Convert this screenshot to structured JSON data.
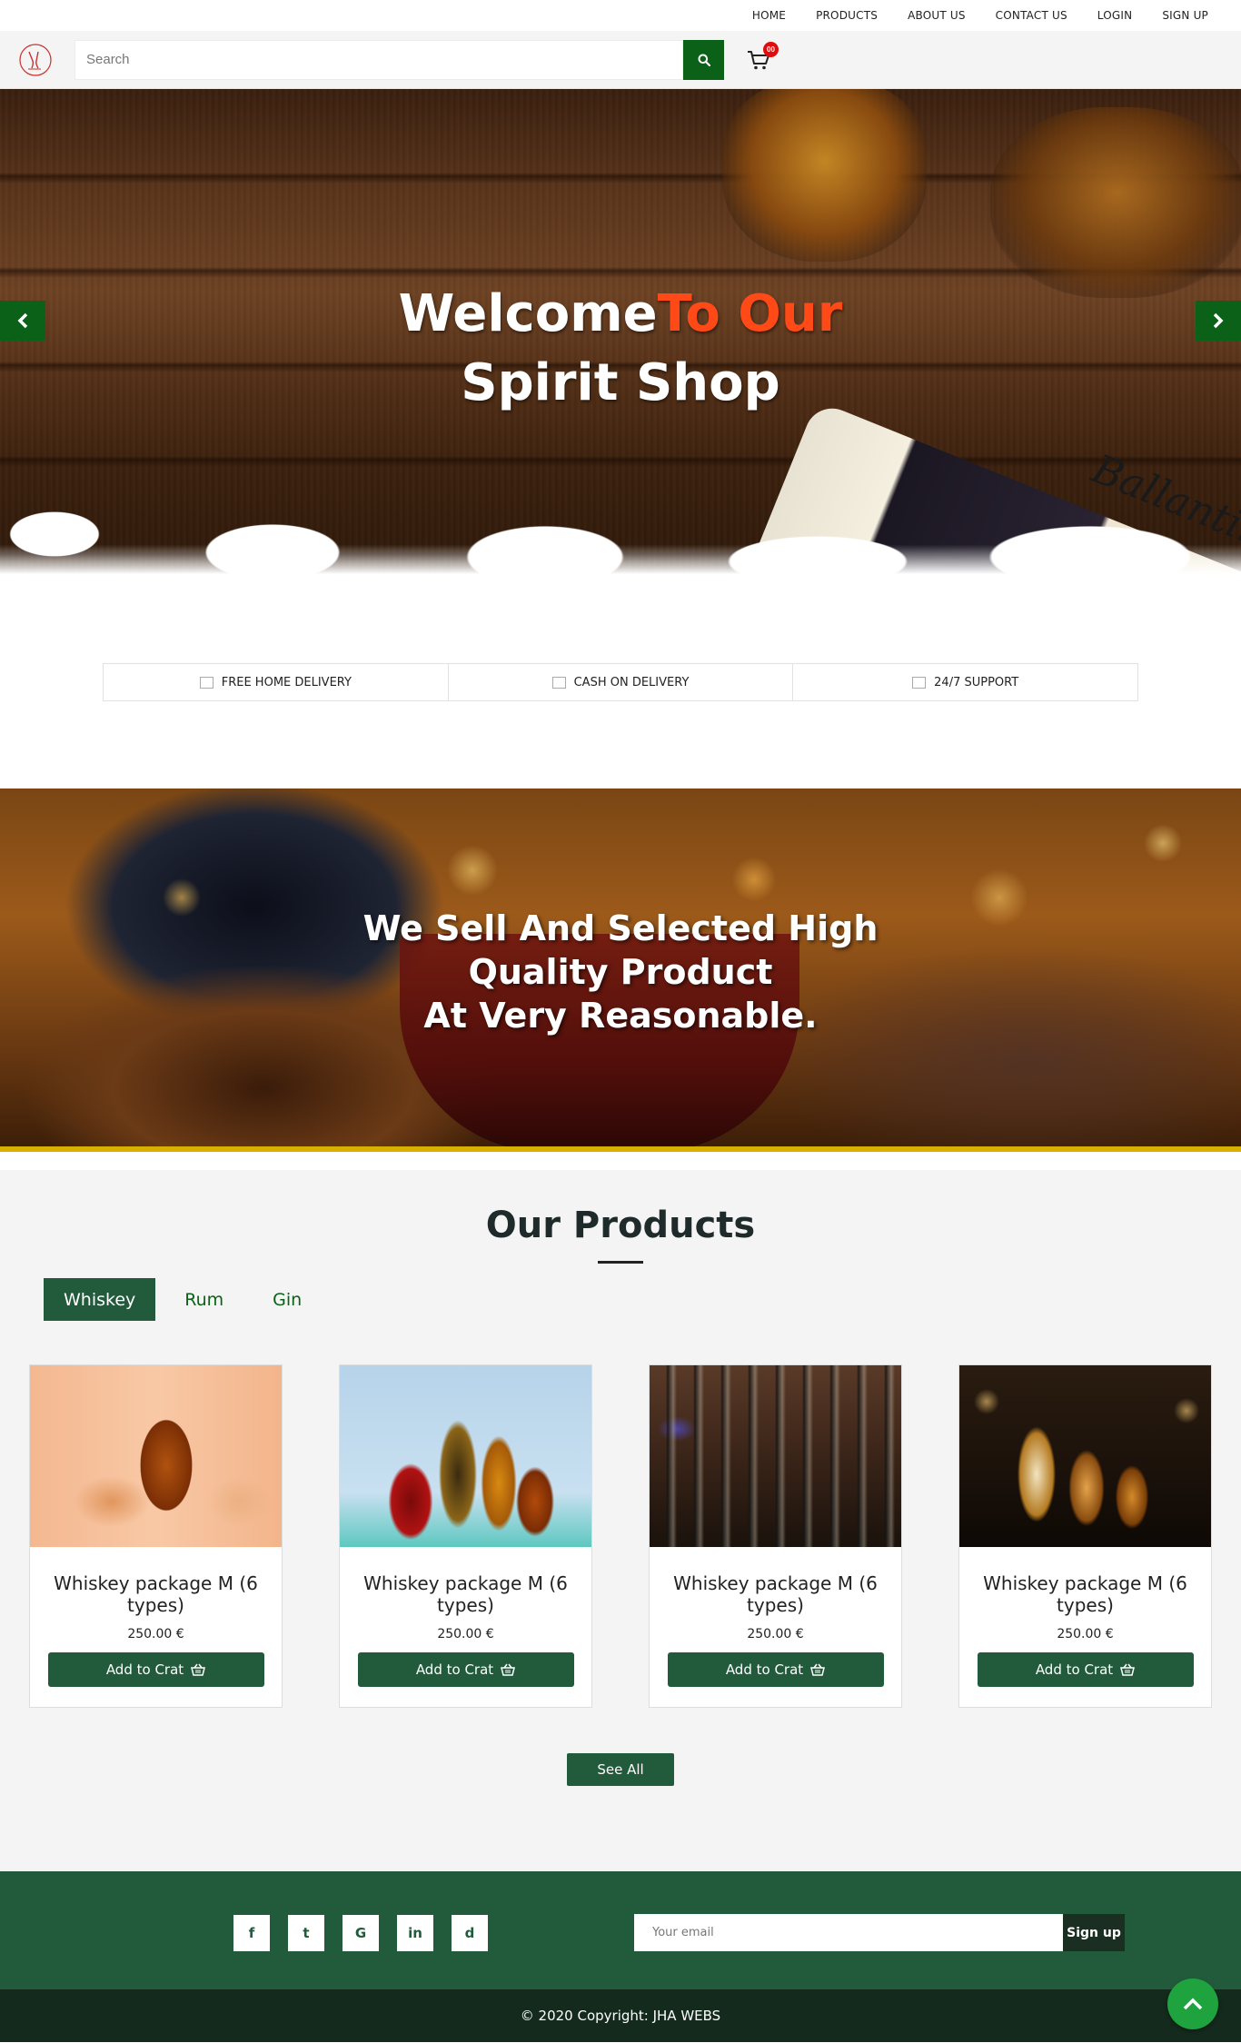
{
  "nav": {
    "items": [
      "HOME",
      "PRODUCTS",
      "ABOUT US",
      "CONTACT US",
      "LOGIN",
      "SIGN UP"
    ]
  },
  "header": {
    "search_placeholder": "Search",
    "cart_count": "00",
    "logo_icon": "wine-glass-logo-icon",
    "search_icon": "search-icon",
    "cart_icon": "shopping-cart-icon"
  },
  "hero": {
    "title_part1": "Welcome",
    "title_part2": "To Our",
    "title_line2": "Spirit Shop",
    "bottle_label": "Ballantine's",
    "accent_color": "#ff4a17"
  },
  "features": [
    {
      "label": "FREE HOME DELIVERY"
    },
    {
      "label": "CASH ON DELIVERY"
    },
    {
      "label": "24/7 SUPPORT"
    }
  ],
  "banner": {
    "line1": "We Sell And Selected High",
    "line2": "Quality Product",
    "line3": "At Very Reasonable."
  },
  "products": {
    "title": "Our Products",
    "tabs": [
      {
        "label": "Whiskey",
        "active": true
      },
      {
        "label": "Rum",
        "active": false
      },
      {
        "label": "Gin",
        "active": false
      }
    ],
    "items": [
      {
        "name": "Whiskey package M (6 types)",
        "price": "250.00 €",
        "button": "Add to Crat"
      },
      {
        "name": "Whiskey package M (6 types)",
        "price": "250.00 €",
        "button": "Add to Crat"
      },
      {
        "name": "Whiskey package M (6 types)",
        "price": "250.00 €",
        "button": "Add to Crat"
      },
      {
        "name": "Whiskey package M (6 types)",
        "price": "250.00 €",
        "button": "Add to Crat"
      }
    ],
    "see_all": "See All"
  },
  "footer": {
    "social": [
      "f",
      "t",
      "G",
      "in",
      "d"
    ],
    "social_icons": [
      "facebook-icon",
      "twitter-icon",
      "google-icon",
      "linkedin-icon",
      "dribbble-icon"
    ],
    "email_placeholder": "Your email",
    "signup": "Sign up",
    "copyright": "© 2020 Copyright: JHA WEBS"
  },
  "colors": {
    "brand_green": "#225b3c",
    "search_green": "#0b6118",
    "badge_red": "#e10b0b",
    "back_top_green": "#1fa33f"
  }
}
